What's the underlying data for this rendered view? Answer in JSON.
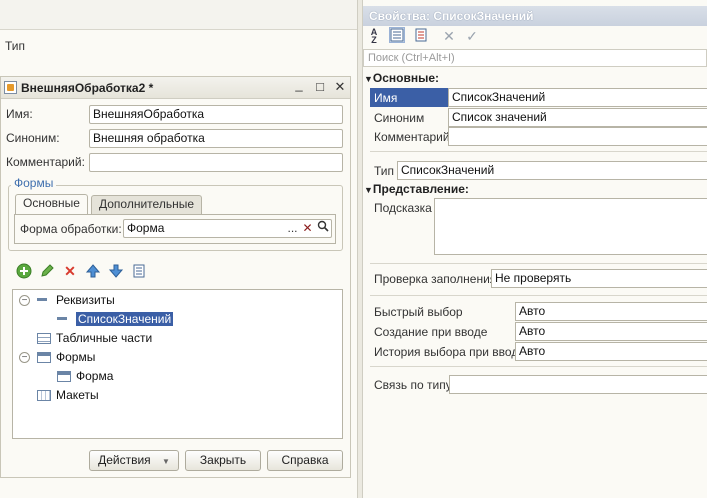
{
  "background": {
    "type_label": "Тип"
  },
  "object_window": {
    "title": "ВнешняяОбработка2 *",
    "buttons": {
      "minimize": "_",
      "maximize": "□",
      "close": "✕"
    },
    "name": {
      "label": "Имя:",
      "value": "ВнешняяОбработка"
    },
    "synonym": {
      "label": "Синоним:",
      "value": "Внешняя обработка"
    },
    "comment": {
      "label": "Комментарий:",
      "value": ""
    },
    "forms_group": {
      "title": "Формы",
      "tabs": [
        {
          "label": "Основные"
        },
        {
          "label": "Дополнительные"
        }
      ],
      "processing_form": {
        "label": "Форма обработки:",
        "value": "Форма",
        "select_btn": "...",
        "clear_btn": "✕"
      }
    },
    "tree": {
      "items": [
        {
          "label": "Реквизиты",
          "toggle": "−"
        },
        {
          "label": "СписокЗначений"
        },
        {
          "label": "Табличные части"
        },
        {
          "label": "Формы",
          "toggle": "−"
        },
        {
          "label": "Форма"
        },
        {
          "label": "Макеты"
        }
      ]
    },
    "footer_buttons": {
      "actions": "Действия",
      "close": "Закрыть",
      "help": "Справка"
    }
  },
  "properties": {
    "title": "Свойства: СписокЗначений",
    "toolbar_icons": [
      "sort-az-icon",
      "categories-icon",
      "settings-icon",
      "close-icon",
      "check-icon"
    ],
    "search_placeholder": "Поиск (Ctrl+Alt+I)",
    "sections": {
      "main": "Основные:",
      "presentation": "Представление:"
    },
    "rows": {
      "name": {
        "label": "Имя",
        "value": "СписокЗначений"
      },
      "synonym": {
        "label": "Синоним",
        "value": "Список значений"
      },
      "comment": {
        "label": "Комментарий",
        "value": ""
      },
      "type": {
        "label": "Тип",
        "value": "СписокЗначений"
      },
      "tooltip": {
        "label": "Подсказка",
        "value": ""
      },
      "fill_check": {
        "label": "Проверка заполнения",
        "value": "Не проверять"
      },
      "quick_choice": {
        "label": "Быстрый выбор",
        "value": "Авто"
      },
      "create_on_input": {
        "label": "Создание при вводе",
        "value": "Авто"
      },
      "choice_history": {
        "label": "История выбора при вводе",
        "value": "Авто"
      },
      "link_by_type": {
        "label": "Связь по типу",
        "value": ""
      }
    }
  },
  "colors": {
    "selection": "#3b5fa6",
    "accent_text": "#3f6fae",
    "panel_header": "#c9d1de"
  }
}
